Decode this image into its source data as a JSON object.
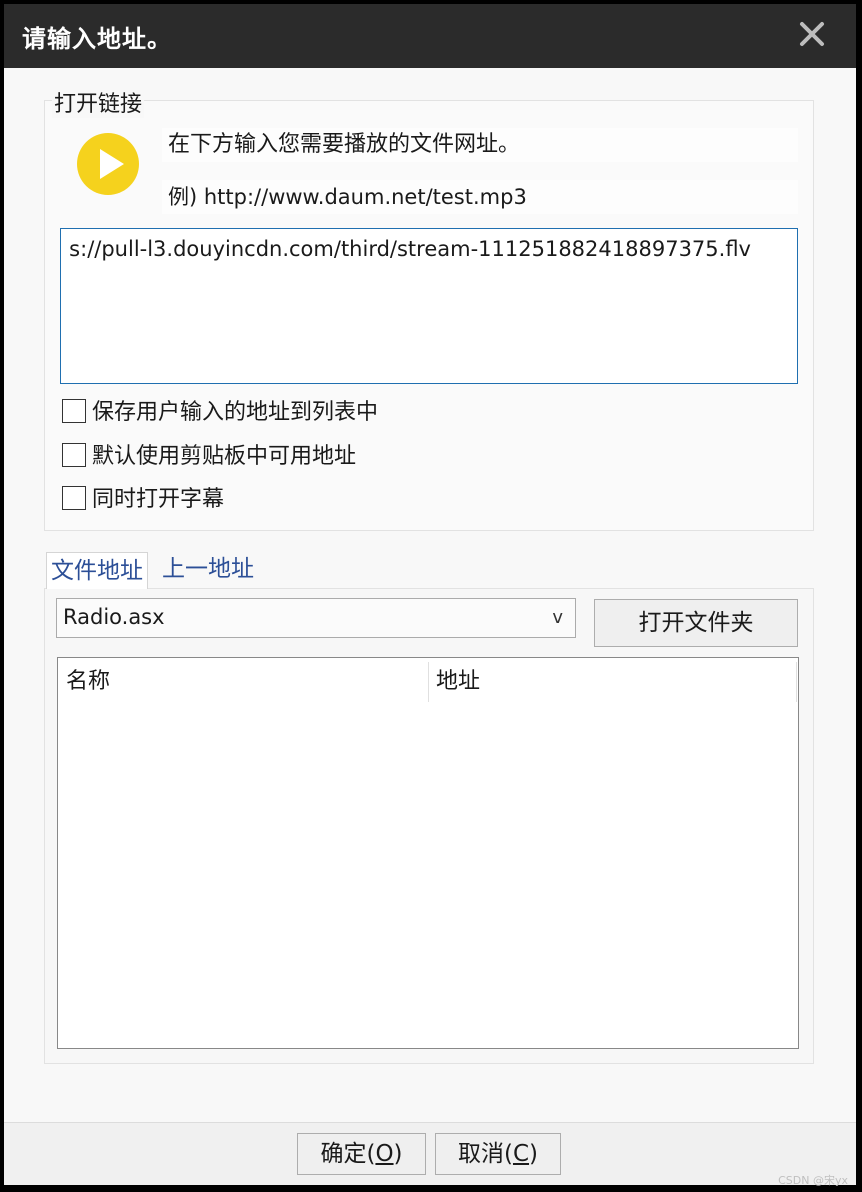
{
  "titlebar": {
    "title": "请输入地址。"
  },
  "open_link": {
    "legend": "打开链接",
    "line1": "在下方输入您需要播放的文件网址。",
    "line2": "例) http://www.daum.net/test.mp3",
    "url_value": "s://pull-l3.douyincdn.com/third/stream-111251882418897375.flv",
    "options": [
      {
        "label": "保存用户输入的地址到列表中",
        "checked": false
      },
      {
        "label": "默认使用剪贴板中可用地址",
        "checked": false
      },
      {
        "label": "同时打开字幕",
        "checked": false
      }
    ]
  },
  "tabs": [
    {
      "label": "文件地址",
      "active": true
    },
    {
      "label": "上一地址",
      "active": false
    }
  ],
  "file_panel": {
    "combo_value": "Radio.asx",
    "combo_arrow": "v",
    "open_folder_label": "打开文件夹",
    "columns": [
      "名称",
      "地址"
    ]
  },
  "footer": {
    "ok_text": "确定(",
    "ok_key": "O",
    "ok_close": ")",
    "cancel_text": "取消(",
    "cancel_key": "C",
    "cancel_close": ")"
  },
  "watermark": "CSDN @宋yx",
  "colors": {
    "titlebar_bg": "#2b2b2b",
    "play_icon": "#f5d21d",
    "tab_text": "#2c4f97",
    "input_border": "#1f6fb0"
  },
  "icons": {
    "close": "close-icon",
    "play": "play-icon"
  }
}
